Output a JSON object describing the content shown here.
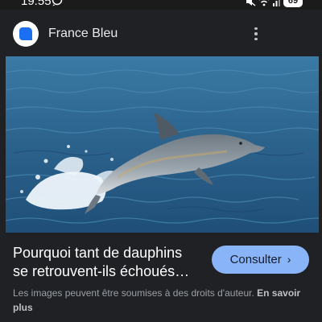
{
  "status_bar": {
    "time": "19:55",
    "battery": "69",
    "icons": [
      "whatsapp-icon",
      "mute-icon",
      "wifi-icon",
      "signal-icon"
    ]
  },
  "source": {
    "name": "France Bleu",
    "logo": "france-bleu-logo",
    "menu_icon": "more-vert-icon"
  },
  "image": {
    "subject": "dolphin-jumping-out-of-sea",
    "colors": {
      "sea": "#2f6a92",
      "dolphin": "#8f9aa3"
    }
  },
  "result": {
    "title_line1": "Pourquoi tant de dauphins",
    "title_line2": "se retrouvent-ils échoués…",
    "button_label": "Consulter",
    "button_icon": "chevron-right-icon"
  },
  "copyright": {
    "text": "Les images peuvent être soumises à des droits d'auteur.",
    "link_label": "En savoir plus"
  },
  "colors": {
    "background": "#202124",
    "accent_button": "#8ab4f8",
    "brand_logo": "#1d6ff2"
  }
}
